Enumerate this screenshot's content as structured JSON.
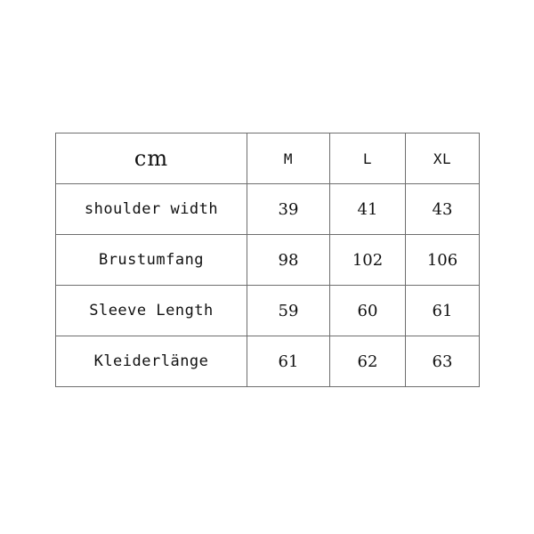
{
  "chart_data": {
    "type": "table",
    "title": "",
    "unit_header": "cm",
    "columns": [
      "cm",
      "M",
      "L",
      "XL"
    ],
    "size_columns": [
      "M",
      "L",
      "XL"
    ],
    "rows": [
      {
        "label": "shoulder width",
        "values": [
          "39",
          "41",
          "43"
        ]
      },
      {
        "label": "Brustumfang",
        "values": [
          "98",
          "102",
          "106"
        ]
      },
      {
        "label": "Sleeve Length",
        "values": [
          "59",
          "60",
          "61"
        ]
      },
      {
        "label": "Kleiderlänge",
        "values": [
          "61",
          "62",
          "63"
        ]
      }
    ]
  },
  "table": {
    "unit_header": "cm",
    "size_headers": [
      "M",
      "L",
      "XL"
    ],
    "rows": [
      {
        "label": "shoulder width",
        "m": "39",
        "l": "41",
        "xl": "43"
      },
      {
        "label": "Brustumfang",
        "m": "98",
        "l": "102",
        "xl": "106"
      },
      {
        "label": "Sleeve Length",
        "m": "59",
        "l": "60",
        "xl": "61"
      },
      {
        "label": "Kleiderlänge",
        "m": "61",
        "l": "62",
        "xl": "63"
      }
    ]
  },
  "colors": {
    "background": "#ffffff",
    "border": "#6e6e6e",
    "text": "#111111"
  }
}
